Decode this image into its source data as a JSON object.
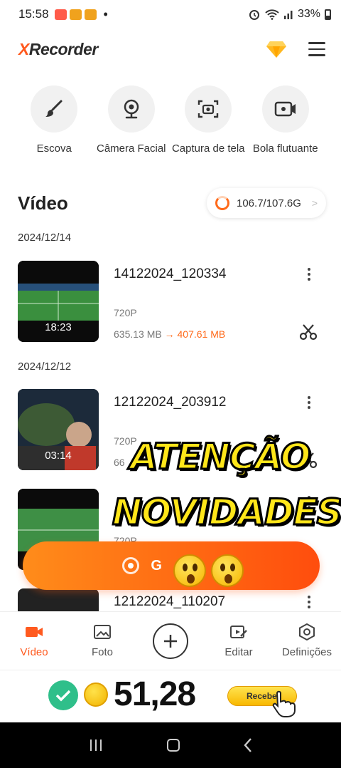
{
  "status_bar": {
    "time": "15:58",
    "battery": "33%"
  },
  "header": {
    "logo_x": "X",
    "logo_rest": "Recorder",
    "premium_icon": "diamond-icon",
    "menu_icon": "hamburger-menu-icon"
  },
  "tools": [
    {
      "label": "Escova",
      "icon": "brush-icon"
    },
    {
      "label": "Câmera Facial",
      "icon": "webcam-icon"
    },
    {
      "label": "Captura de tela",
      "icon": "screenshot-icon"
    },
    {
      "label": "Bola flutuante",
      "icon": "floating-ball-icon"
    }
  ],
  "section": {
    "title": "Vídeo",
    "storage": "106.7/107.6G"
  },
  "videos": [
    {
      "date": "2024/12/14",
      "name": "14122024_120334",
      "duration": "18:23",
      "resolution": "720P",
      "size_old": "635.13 MB",
      "arrow": "→",
      "size_new": "407.61 MB"
    },
    {
      "date": "2024/12/12",
      "name": "12122024_203912",
      "duration": "03:14",
      "resolution": "720P",
      "size_old": "66",
      "arrow": "",
      "size_new": ""
    },
    {
      "date": "",
      "name": "",
      "duration": "",
      "resolution": "720P",
      "size_old": "",
      "arrow": "",
      "size_new": ""
    },
    {
      "date": "",
      "name": "12122024_110207",
      "duration": "",
      "resolution": "",
      "size_old": "",
      "arrow": "",
      "size_new": ""
    }
  ],
  "overlay": {
    "line1": "ATENÇÃO",
    "line2": "NOVIDADES"
  },
  "record_button": {
    "label": "G",
    "label_tail": "r"
  },
  "bottom_nav": [
    {
      "label": "Vídeo",
      "icon": "video-camera-icon",
      "active": true
    },
    {
      "label": "Foto",
      "icon": "photo-icon",
      "active": false
    },
    {
      "label": "",
      "icon": "plus-icon",
      "active": false
    },
    {
      "label": "Editar",
      "icon": "edit-icon",
      "active": false
    },
    {
      "label": "Definições",
      "icon": "settings-icon",
      "active": false
    }
  ],
  "promo": {
    "amount": "51,28",
    "receive_label": "Recebe"
  },
  "colors": {
    "accent": "#ff5a1f",
    "record_gradient_start": "#ff8c1a",
    "record_gradient_end": "#ff4d0d",
    "overlay_yellow": "#ffe619"
  }
}
